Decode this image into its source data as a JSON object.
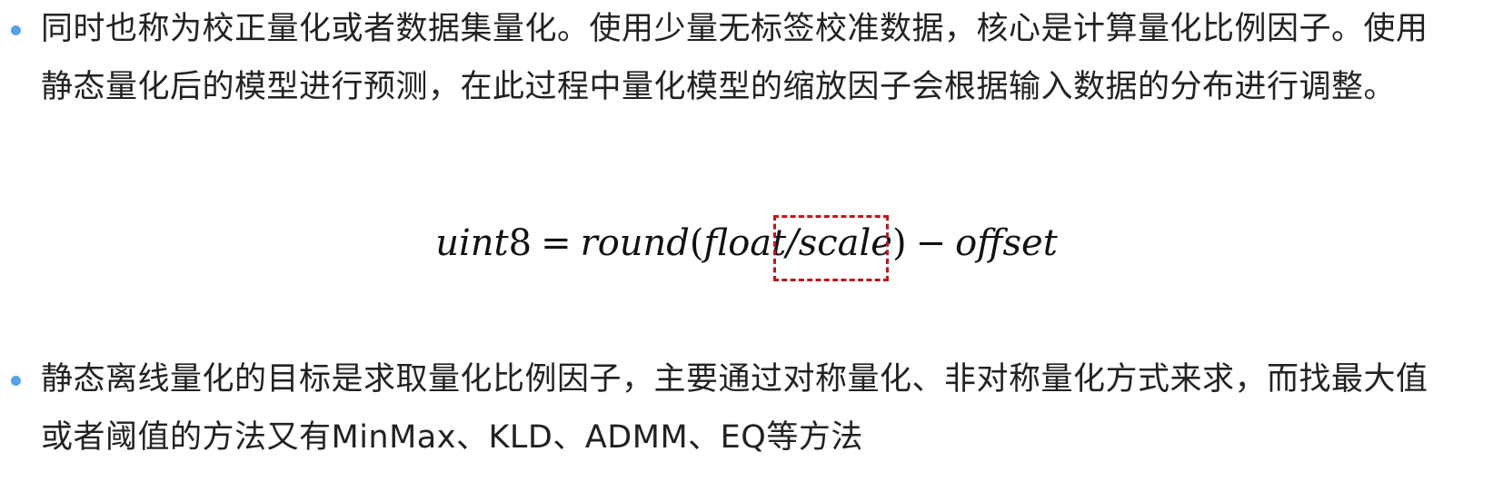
{
  "bullets": [
    {
      "text": "同时也称为校正量化或者数据集量化。使用少量无标签校准数据，核心是计算量化比例因子。使用静态量化后的模型进行预测，在此过程中量化模型的缩放因子会根据输入数据的分布进行调整。"
    },
    {
      "text": "静态离线量化的目标是求取量化比例因子，主要通过对称量化、非对称量化方式来求，而找最大值或者阈值的方法又有MinMax、KLD、ADMM、EQ等方法"
    }
  ],
  "formula": {
    "lhs_var": "uint",
    "lhs_num": "8",
    "equals": "=",
    "func": "round",
    "open_paren": "(",
    "arg_num": "float",
    "slash": "/",
    "arg_den": "scale",
    "close_paren": ")",
    "minus": "−",
    "offset": "offset"
  },
  "highlight": {
    "color": "#c0161b",
    "style": "dashed",
    "target": "/scale)"
  },
  "colors": {
    "bullet": "#5aa0e6",
    "text": "#222222"
  }
}
